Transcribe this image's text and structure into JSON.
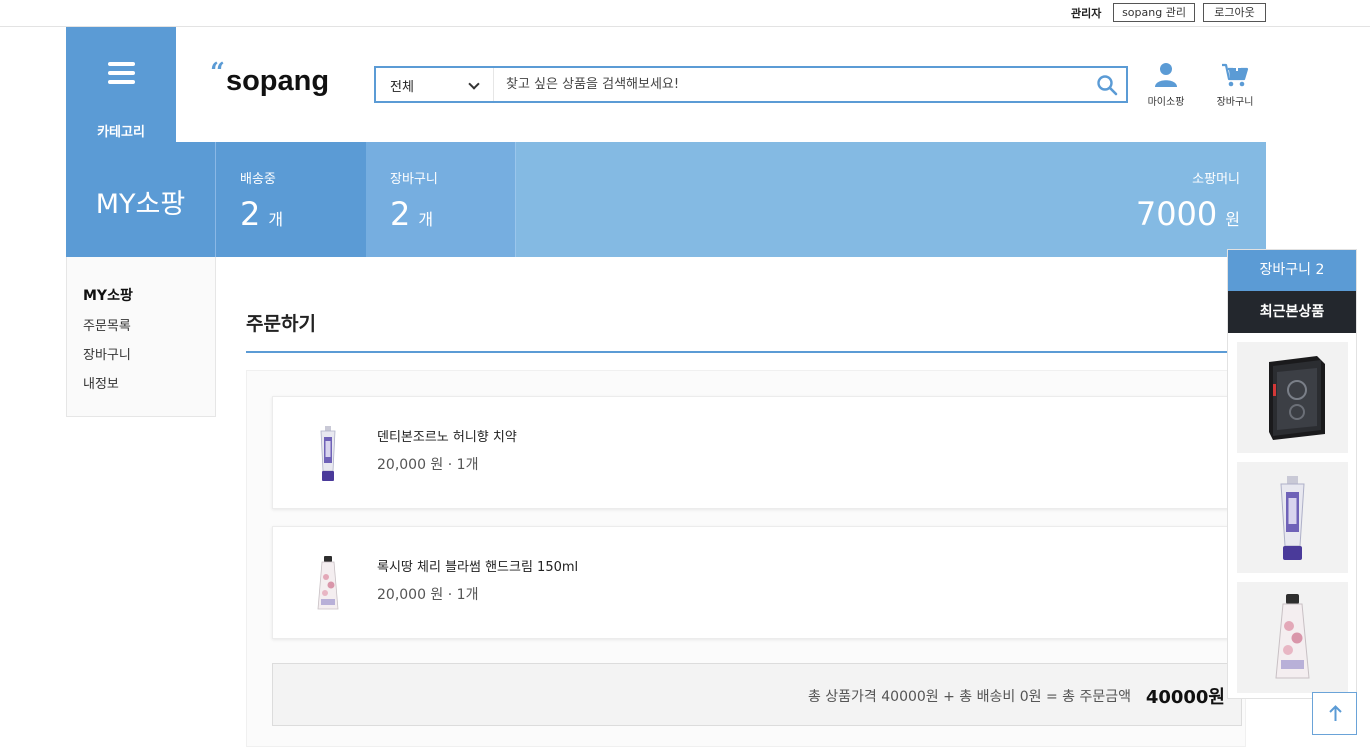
{
  "topbar": {
    "admin_label": "관리자",
    "admin_button": "sopang 관리",
    "logout_button": "로그아웃"
  },
  "header": {
    "category_label": "카테고리",
    "logo_text": "sopang",
    "search": {
      "selected_category": "전체",
      "placeholder": "찾고 싶은 상품을 검색해보세요!"
    },
    "my_label": "마이소팡",
    "cart_label": "장바구니"
  },
  "summary": {
    "title": "MY소팡",
    "shipping": {
      "label": "배송중",
      "value": "2",
      "unit": "개"
    },
    "cart": {
      "label": "장바구니",
      "value": "2",
      "unit": "개"
    },
    "money": {
      "label": "소팡머니",
      "value": "7000",
      "unit": "원"
    }
  },
  "sidebar": {
    "heading": "MY소팡",
    "items": [
      "주문목록",
      "장바구니",
      "내정보"
    ]
  },
  "main": {
    "title": "주문하기",
    "orders": [
      {
        "name": "덴티본조르노 허니향 치약",
        "price": "20,000 원 · 1개",
        "thumb": "toothpaste-thumb"
      },
      {
        "name": "록시땅 체리 블라썸 핸드크림 150ml",
        "price": "20,000 원 · 1개",
        "thumb": "handcream-thumb"
      }
    ],
    "total_formula": "총 상품가격 40000원 + 총 배송비 0원 = 총 주문금액",
    "total_amount": "40000원"
  },
  "float_panel": {
    "cart_button": "장바구니 2",
    "recent_label": "최근본상품",
    "recent_items": [
      "pc-case-thumb",
      "toothpaste-thumb",
      "handcream-thumb"
    ]
  },
  "colors": {
    "accent": "#5b9bd5",
    "dark": "#23272d"
  }
}
